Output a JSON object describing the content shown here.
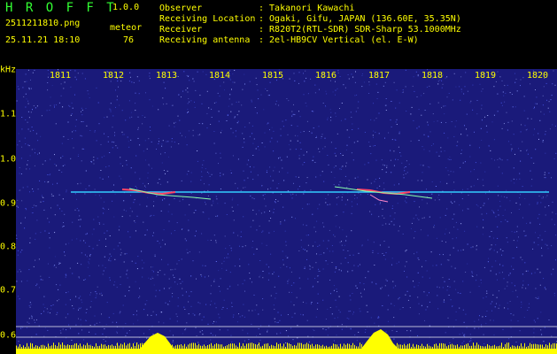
{
  "header": {
    "app_name": "H R O F F T",
    "version": "1.0.0",
    "filename": "2511211810.png",
    "datetime": "25.11.21 18:10",
    "meteor_label": "meteor",
    "meteor_count": "76",
    "info": [
      {
        "label": "Observer",
        "value": ": Takanori Kawachi"
      },
      {
        "label": "Receiving Location",
        "value": ": Ogaki, Gifu, JAPAN (136.60E, 35.35N)"
      },
      {
        "label": "Receiver",
        "value": ": R820T2(RTL-SDR) SDR-Sharp 53.1000MHz"
      },
      {
        "label": "Receiving antenna",
        "value": ": 2el-HB9CV Vertical (el. E-W)"
      }
    ]
  },
  "spectrogram": {
    "y_unit": "kHz",
    "y_ticks": [
      "1.1",
      "1.0",
      "0.9",
      "0.8",
      "0.7",
      "0.6"
    ],
    "x_ticks": [
      "1811",
      "1812",
      "1813",
      "1814",
      "1815",
      "1816",
      "1817",
      "1818",
      "1819",
      "1820"
    ],
    "colors": {
      "background": "#1a1a7a",
      "noise": "#6a7aff",
      "carrier": "#33ccff",
      "meteor": "#ff4466",
      "level": "#ffff00",
      "hud_text": "#ffff00"
    }
  }
}
